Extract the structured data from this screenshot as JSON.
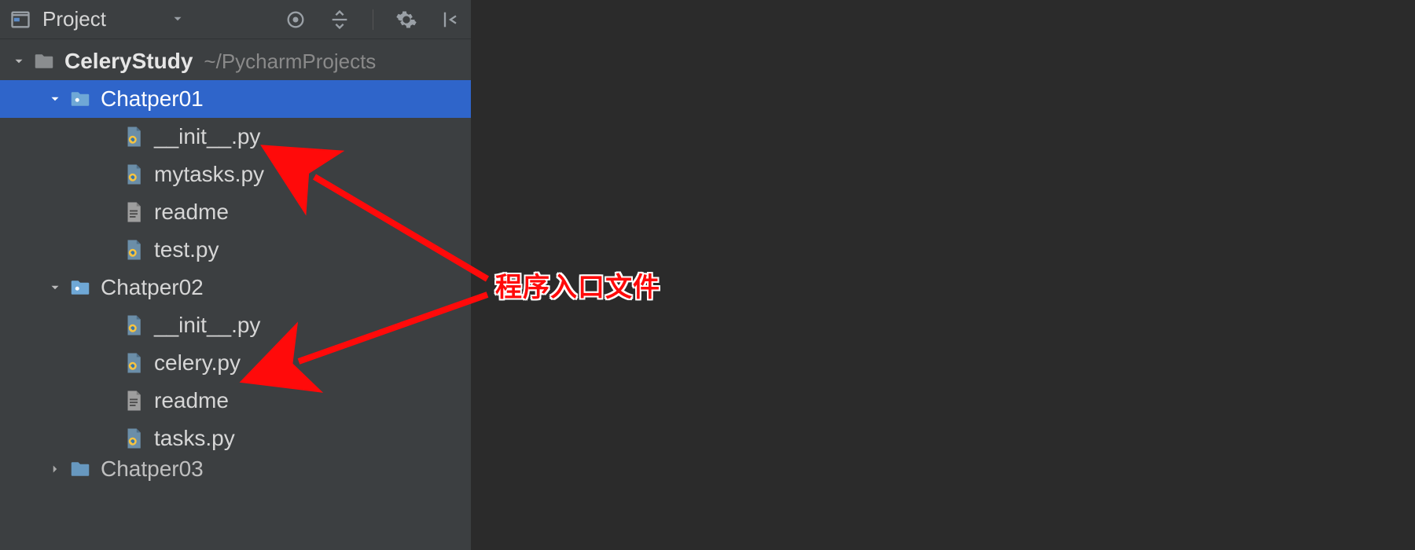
{
  "toolbar": {
    "title": "Project"
  },
  "tree": {
    "root": {
      "name": "CeleryStudy",
      "path": "~/PycharmProjects"
    },
    "chapter01": {
      "name": "Chatper01",
      "files": {
        "init": "__init__.py",
        "mytasks": "mytasks.py",
        "readme": "readme",
        "test": "test.py"
      }
    },
    "chapter02": {
      "name": "Chatper02",
      "files": {
        "init": "__init__.py",
        "celery": "celery.py",
        "readme": "readme",
        "tasks": "tasks.py"
      }
    },
    "chapter03": {
      "name": "Chatper03"
    }
  },
  "annotation": "程序入口文件"
}
